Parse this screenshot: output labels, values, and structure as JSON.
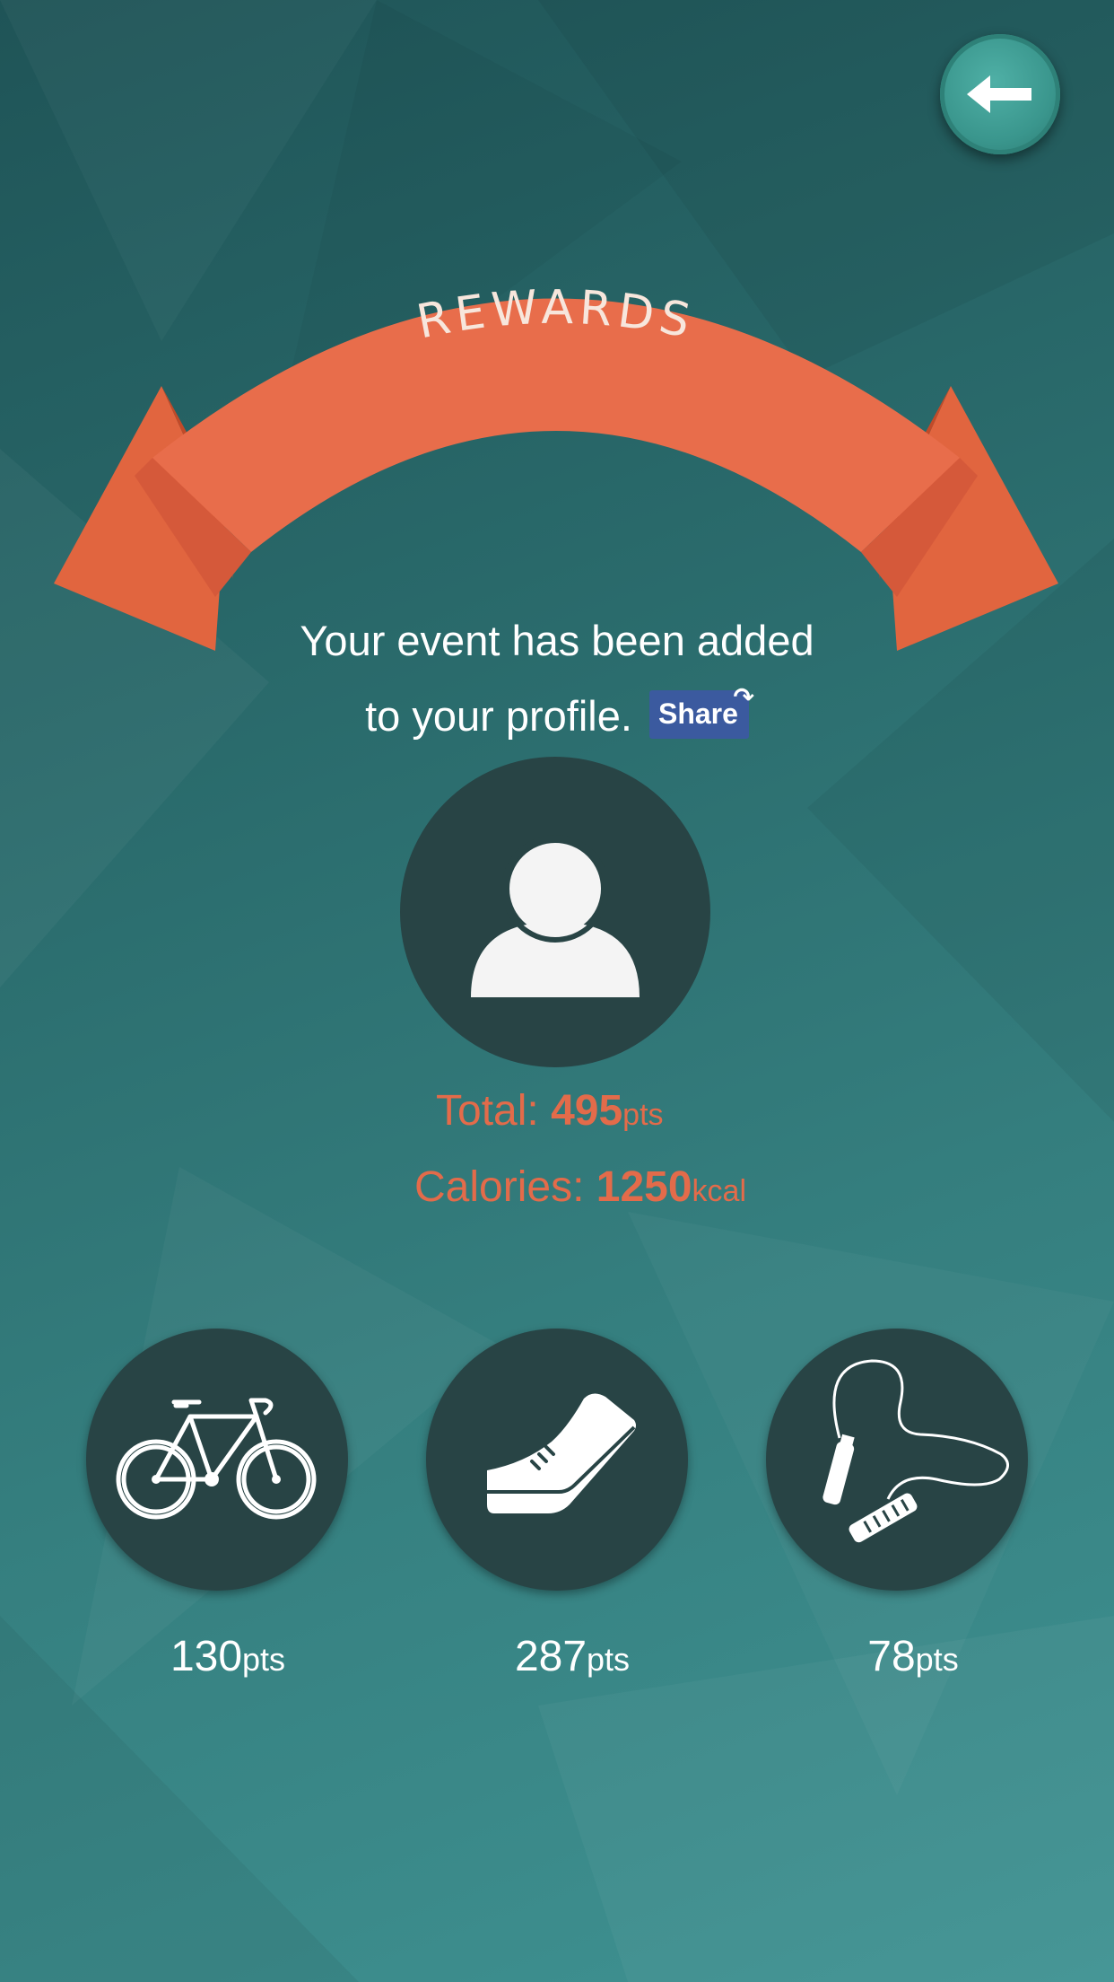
{
  "header": {
    "back_icon": "arrow-left-icon"
  },
  "banner": {
    "title": "REWARDS"
  },
  "message": {
    "line1": "Your event has been added",
    "line2": "to your profile.",
    "share_label": "Share"
  },
  "avatar": {
    "icon": "user-silhouette-icon"
  },
  "stats": {
    "total_label": "Total:",
    "total_value": "495",
    "total_unit": "pts",
    "calories_label": "Calories:",
    "calories_value": "1250",
    "calories_unit": "kcal"
  },
  "activities": [
    {
      "icon": "bicycle-icon",
      "value": "130",
      "unit": "pts"
    },
    {
      "icon": "sneaker-icon",
      "value": "287",
      "unit": "pts"
    },
    {
      "icon": "jump-rope-icon",
      "value": "78",
      "unit": "pts"
    }
  ],
  "colors": {
    "accent": "#e36b4a",
    "circle_fill": "#284445",
    "share_blue": "#3b5a9f",
    "back_button": "#3a968d"
  }
}
